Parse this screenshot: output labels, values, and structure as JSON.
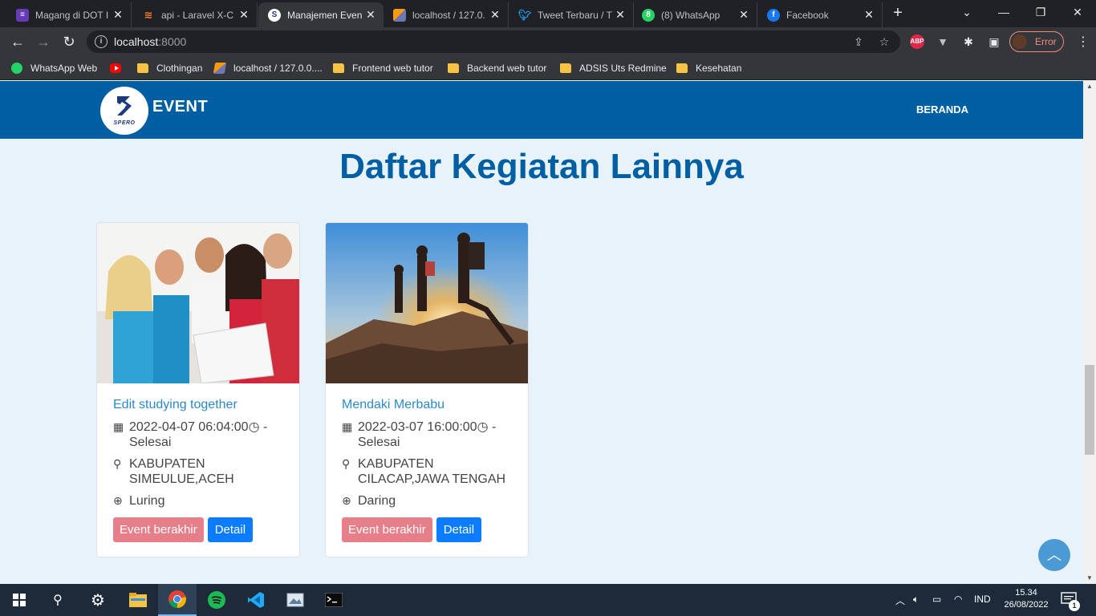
{
  "browser": {
    "tabs": [
      {
        "title": "Magang di DOT I",
        "icon": "list-icon",
        "color": "#673ab7"
      },
      {
        "title": "api - Laravel X-C",
        "icon": "stackoverflow-icon",
        "color": "#f48024"
      },
      {
        "title": "Manajemen Even",
        "icon": "spero-icon",
        "color": "#ffffff"
      },
      {
        "title": "localhost / 127.0.",
        "icon": "phpmyadmin-icon",
        "color": "#f89c0e"
      },
      {
        "title": "Tweet Terbaru / T",
        "icon": "twitter-icon",
        "color": "#1d9bf0"
      },
      {
        "title": "(8) WhatsApp",
        "icon": "whatsapp-icon",
        "color": "#25d366"
      },
      {
        "title": "Facebook",
        "icon": "facebook-icon",
        "color": "#1877f2"
      }
    ],
    "url_host": "localhost",
    "url_port": ":8000",
    "profile_label": "Error",
    "ext_abp": "ABP",
    "bookmarks": [
      {
        "label": "WhatsApp Web",
        "icon": "whatsapp-icon"
      },
      {
        "label": "",
        "icon": "youtube-icon"
      },
      {
        "label": "Clothingan",
        "icon": "folder-icon"
      },
      {
        "label": "localhost / 127.0.0....",
        "icon": "phpmyadmin-icon"
      },
      {
        "label": "Frontend web tutor",
        "icon": "folder-icon"
      },
      {
        "label": "Backend web tutor",
        "icon": "folder-icon"
      },
      {
        "label": "ADSIS Uts Redmine",
        "icon": "folder-icon"
      },
      {
        "label": "Kesehatan",
        "icon": "folder-icon"
      }
    ]
  },
  "site": {
    "logo_text": "SPERO",
    "brand": "EVENT",
    "nav_home": "BERANDA",
    "page_title": "Daftar Kegiatan Lainnya",
    "colors": {
      "primary": "#005fa3",
      "background": "#e8f2fa",
      "ended": "#e77f8a",
      "detail": "#0b7cff"
    },
    "events": [
      {
        "title": "Edit studying together",
        "datetime": "2022-04-07 06:04:00",
        "end": " - Selesai",
        "location": "KABUPATEN SIMEULUE,ACEH",
        "mode": "Luring",
        "status_label": "Event berakhir",
        "detail_label": "Detail"
      },
      {
        "title": "Mendaki Merbabu",
        "datetime": "2022-03-07 16:00:00",
        "end": " - Selesai",
        "location": "KABUPATEN CILACAP,JAWA TENGAH",
        "mode": "Daring",
        "status_label": "Event berakhir",
        "detail_label": "Detail"
      }
    ]
  },
  "taskbar": {
    "language": "IND",
    "time": "15.34",
    "date": "26/08/2022",
    "notification_count": "1"
  }
}
